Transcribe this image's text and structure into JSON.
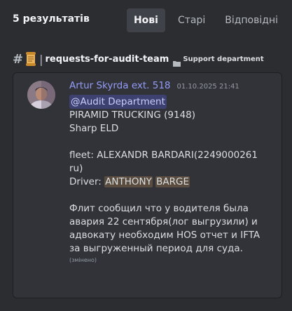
{
  "header": {
    "result_count": "5 результатів",
    "tabs": [
      {
        "label": "Нові",
        "active": true
      },
      {
        "label": "Старі",
        "active": false
      },
      {
        "label": "Відповідні",
        "active": false
      }
    ]
  },
  "channel": {
    "hash_glyph": "#",
    "separator": "|",
    "name": "requests-for-audit-team",
    "category": "Support department"
  },
  "message": {
    "author": "Artur Skyrda ext. 518",
    "timestamp": "01.10.2025 21:41",
    "mention": "@Audit Department",
    "line1": "PIRAMID TRUCKING (9148)",
    "line2": "Sharp ELD",
    "line3": "fleet: ALEXANDR BARDARI(2249000261",
    "line4": "ru)",
    "driver_prefix": "Driver: ",
    "driver_first": "ANTHONY",
    "driver_last": "BARGE",
    "line6": "Флит сообщил что у водителя была",
    "line7": "авария 22 сентября(лог выгрузили) и",
    "line8": "адвокату необходим HOS отчет и IFTA",
    "line9": "за выгруженный период для суда.",
    "edited": "(змінено)"
  },
  "colors": {
    "background": "#2b2d31",
    "card": "#313338",
    "author": "#949cf7",
    "highlight": "#5a4d3f"
  }
}
